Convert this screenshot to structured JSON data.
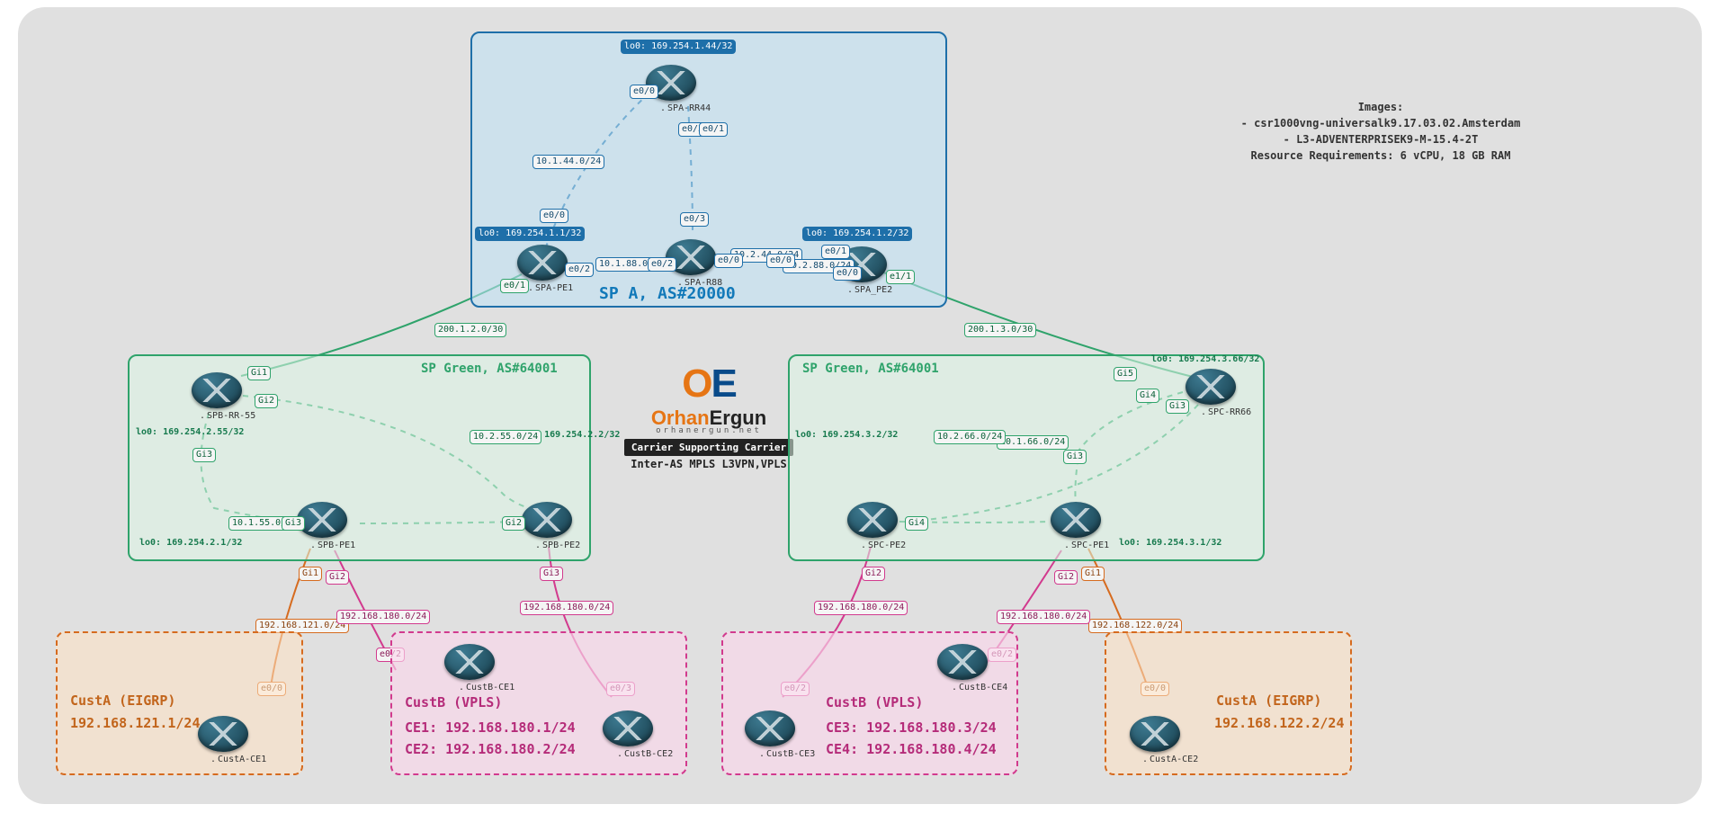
{
  "info": {
    "heading": "Images:",
    "line1": "- csr1000vng-universalk9.17.03.02.Amsterdam",
    "line2": "- L3-ADVENTERPRISEK9-M-15.4-2T",
    "line3": "Resource Requirements: 6 vCPU, 18 GB RAM"
  },
  "logo": {
    "brand1": "Orhan",
    "brand2": "Ergun",
    "site": "orhanergun.net",
    "bar": "Carrier Supporting Carrier",
    "sub2": "Inter-AS MPLS L3VPN,VPLS"
  },
  "spa": {
    "title": "SP A, AS#20000",
    "rr44": {
      "name": "SPA-RR44",
      "lo": "lo0: 169.254.1.44/32"
    },
    "pe1": {
      "name": "SPA-PE1",
      "lo": "lo0: 169.254.1.1/32"
    },
    "r88": {
      "name": "SPA-R88"
    },
    "pe2": {
      "name": "SPA_PE2",
      "lo": "lo0: 169.254.1.2/32"
    },
    "net1": "10.1.44.0/24",
    "net2": "10.1.88.0/24",
    "net3": "10.2.44.0/24",
    "net4": "10.2.88.0/24",
    "i_e00a": "e0/0",
    "i_e00b": "e0/0",
    "i_e00c": "e0/0",
    "i_e00d": "e0/0",
    "i_e00e": "e0/0",
    "i_e01a": "e0/1",
    "i_e01b": "e0/1",
    "i_e01c": "e0/1",
    "i_e02a": "e0/2",
    "i_e02b": "e0/2",
    "i_e03a": "e0/3",
    "i_e03b": "e0/3",
    "i_e11": "e1/1"
  },
  "interas": {
    "left": "200.1.2.0/30",
    "right": "200.1.3.0/30"
  },
  "spbL": {
    "title": "SP Green, AS#64001",
    "rr55": {
      "name": "SPB-RR-55",
      "lo": "lo0: 169.254.2.55/32"
    },
    "pe1": {
      "name": "SPB-PE1",
      "lo": "lo0: 169.254.2.1/32"
    },
    "pe2": {
      "name": "SPB-PE2",
      "lo": "lo0: 169.254.2.2/32"
    },
    "net1": "10.1.55.0/24",
    "net2": "10.2.55.0/24",
    "gi1": "Gi1",
    "gi2a": "Gi2",
    "gi2b": "Gi2",
    "gi3a": "Gi3",
    "gi3b": "Gi3"
  },
  "spbR": {
    "title": "SP Green, AS#64001",
    "rr66": {
      "name": "SPC-RR66",
      "lo": "lo0: 169.254.3.66/32"
    },
    "pe1": {
      "name": "SPC-PE1",
      "lo": "lo0: 169.254.3.1/32"
    },
    "pe2": {
      "name": "SPC-PE2",
      "lo": "lo0: 169.254.3.2/32"
    },
    "net1": "10.1.66.0/24",
    "net2": "10.2.66.0/24",
    "gi3a": "Gi3",
    "gi3b": "Gi3",
    "gi4a": "Gi4",
    "gi4b": "Gi4",
    "gi5": "Gi5"
  },
  "pelinks": {
    "L_gi1": "Gi1",
    "L_gi2": "Gi2",
    "L_gi3": "Gi3",
    "R_gi1": "Gi1",
    "R_gi2a": "Gi2",
    "R_gi2b": "Gi2",
    "custA_L": "192.168.121.0/24",
    "custA_R": "192.168.122.0/24",
    "custB_a": "192.168.180.0/24",
    "custB_b": "192.168.180.0/24",
    "custB_c": "192.168.180.0/24",
    "custB_d": "192.168.180.0/24",
    "e00a": "e0/0",
    "e00b": "e0/0",
    "e02a": "e0/2",
    "e02b": "e0/2",
    "e02c": "e0/2",
    "e02d": "e0/2",
    "e03": "e0/3"
  },
  "custA_L": {
    "title": "CustA (EIGRP)",
    "net": "192.168.121.1/24",
    "ce": "CustA-CE1"
  },
  "custA_R": {
    "title": "CustA (EIGRP)",
    "net": "192.168.122.2/24",
    "ce": "CustA-CE2"
  },
  "custB_L": {
    "title": "CustB (VPLS)",
    "l1": "CE1: 192.168.180.1/24",
    "l2": "CE2: 192.168.180.2/24",
    "ce1": "CustB-CE1",
    "ce2": "CustB-CE2"
  },
  "custB_R": {
    "title": "CustB (VPLS)",
    "l1": "CE3: 192.168.180.3/24",
    "l2": "CE4: 192.168.180.4/24",
    "ce3": "CustB-CE3",
    "ce4": "CustB-CE4"
  }
}
